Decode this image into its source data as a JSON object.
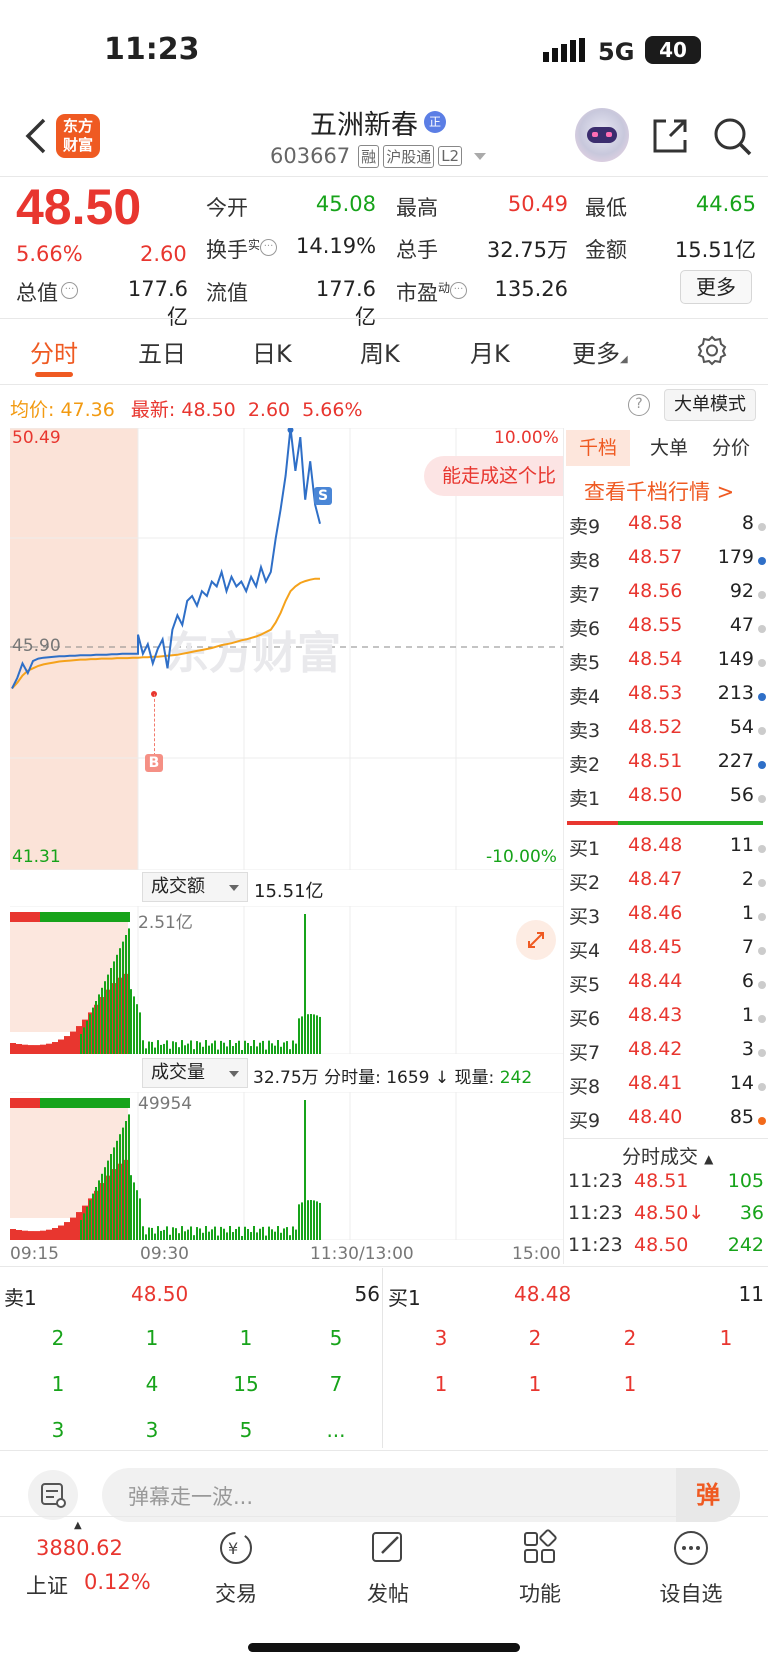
{
  "status_bar": {
    "time": "11:23",
    "network": "5G",
    "battery": "40"
  },
  "header": {
    "logo_line1": "东方",
    "logo_line2": "财富",
    "title": "五洲新春",
    "title_badge": "正",
    "code": "603667",
    "tags": [
      "融",
      "沪股通",
      "L2"
    ]
  },
  "quote": {
    "price": "48.50",
    "change_pct": "5.66%",
    "change": "2.60",
    "open_label": "今开",
    "open": "45.08",
    "high_label": "最高",
    "high": "50.49",
    "low_label": "最低",
    "low": "44.65",
    "turnover_label": "换手",
    "turnover_sup": "实",
    "turnover": "14.19%",
    "volume_label": "总手",
    "volume": "32.75万",
    "amount_label": "金额",
    "amount": "15.51亿",
    "mcap_label": "总值",
    "mcap": "177.6亿",
    "float_label": "流值",
    "float": "177.6亿",
    "pe_label": "市盈",
    "pe_sup": "动",
    "pe": "135.26",
    "more_button": "更多"
  },
  "tabs": [
    "分时",
    "五日",
    "日K",
    "周K",
    "月K",
    "更多"
  ],
  "chart_info": {
    "avg_label": "均价:",
    "avg": "47.36",
    "last_label": "最新:",
    "last": "48.50",
    "last_change": "2.60",
    "last_pct": "5.66%",
    "mode_button": "大单模式",
    "y_max": "50.49",
    "y_mid": "45.90",
    "y_min": "41.31",
    "pct_max": "10.00%",
    "pct_min": "-10.00%",
    "marker_s": "S",
    "marker_b": "B",
    "banner": "能走成这个比",
    "watermark": "东方财富"
  },
  "chart_data": {
    "type": "line",
    "ylim": [
      41.31,
      50.49
    ],
    "series": [
      {
        "name": "最新",
        "values": [
          45.08,
          45.3,
          45.6,
          45.4,
          45.65,
          45.7,
          45.72,
          45.73,
          45.74,
          45.75,
          45.75,
          45.76,
          45.76,
          45.77,
          45.77,
          45.77,
          45.78,
          45.78,
          45.78,
          45.79,
          45.79,
          45.8,
          45.8,
          45.8,
          45.8,
          46.2,
          45.8,
          46.0,
          45.6,
          45.9,
          46.1,
          45.5,
          46.3,
          46.6,
          46.4,
          46.9,
          47.0,
          46.8,
          47.1,
          47.0,
          47.3,
          47.2,
          47.5,
          47.1,
          47.4,
          47.2,
          47.3,
          47.1,
          47.4,
          47.2,
          47.6,
          47.3,
          47.5,
          48.2,
          48.8,
          49.5,
          50.49,
          49.6,
          50.3,
          49.0,
          49.8,
          48.9,
          48.5
        ]
      },
      {
        "name": "均价",
        "values": [
          45.08,
          45.2,
          45.35,
          45.45,
          45.5,
          45.55,
          45.58,
          45.6,
          45.62,
          45.64,
          45.65,
          45.66,
          45.67,
          45.68,
          45.68,
          45.69,
          45.69,
          45.7,
          45.7,
          45.7,
          45.71,
          45.71,
          45.71,
          45.72,
          45.72,
          45.72,
          45.73,
          45.73,
          45.74,
          45.74,
          45.75,
          45.76,
          45.77,
          45.78,
          45.8,
          45.82,
          45.84,
          45.86,
          45.88,
          45.9,
          45.92,
          45.95,
          45.98,
          46.0,
          46.02,
          46.05,
          46.08,
          46.1,
          46.13,
          46.16,
          46.2,
          46.25,
          46.3,
          46.45,
          46.65,
          46.9,
          47.1,
          47.2,
          47.27,
          47.31,
          47.34,
          47.36,
          47.36
        ]
      }
    ]
  },
  "amount_panel": {
    "selector": "成交额",
    "total": "15.51亿",
    "max": "2.51亿"
  },
  "volume_panel": {
    "selector": "成交量",
    "total": "32.75万",
    "minute_label": "分时量:",
    "minute": "1659",
    "cur_label": "现量:",
    "cur": "242",
    "max": "49954"
  },
  "time_axis": [
    "09:15",
    "09:30",
    "11:30/13:00",
    "15:00"
  ],
  "orderbook": {
    "tabs": [
      "千档",
      "大单",
      "分价"
    ],
    "link": "查看千档行情 >",
    "asks": [
      {
        "label": "卖9",
        "price": "48.58",
        "vol": "8",
        "dot": "#cccccc"
      },
      {
        "label": "卖8",
        "price": "48.57",
        "vol": "179",
        "dot": "#2f6fc7"
      },
      {
        "label": "卖7",
        "price": "48.56",
        "vol": "92",
        "dot": "#cccccc"
      },
      {
        "label": "卖6",
        "price": "48.55",
        "vol": "47",
        "dot": "#cccccc"
      },
      {
        "label": "卖5",
        "price": "48.54",
        "vol": "149",
        "dot": "#cccccc"
      },
      {
        "label": "卖4",
        "price": "48.53",
        "vol": "213",
        "dot": "#2f6fc7"
      },
      {
        "label": "卖3",
        "price": "48.52",
        "vol": "54",
        "dot": "#cccccc"
      },
      {
        "label": "卖2",
        "price": "48.51",
        "vol": "227",
        "dot": "#2f6fc7"
      },
      {
        "label": "卖1",
        "price": "48.50",
        "vol": "56",
        "dot": "#cccccc"
      }
    ],
    "bids": [
      {
        "label": "买1",
        "price": "48.48",
        "vol": "11",
        "dot": "#cccccc"
      },
      {
        "label": "买2",
        "price": "48.47",
        "vol": "2",
        "dot": "#cccccc"
      },
      {
        "label": "买3",
        "price": "48.46",
        "vol": "1",
        "dot": "#cccccc"
      },
      {
        "label": "买4",
        "price": "48.45",
        "vol": "7",
        "dot": "#cccccc"
      },
      {
        "label": "买5",
        "price": "48.44",
        "vol": "6",
        "dot": "#cccccc"
      },
      {
        "label": "买6",
        "price": "48.43",
        "vol": "1",
        "dot": "#cccccc"
      },
      {
        "label": "买7",
        "price": "48.42",
        "vol": "3",
        "dot": "#cccccc"
      },
      {
        "label": "买8",
        "price": "48.41",
        "vol": "14",
        "dot": "#cccccc"
      },
      {
        "label": "买9",
        "price": "48.40",
        "vol": "85",
        "dot": "#f26a1b"
      }
    ],
    "ticks_title": "分时成交",
    "ticks": [
      {
        "time": "11:23",
        "price": "48.51",
        "vol": "105"
      },
      {
        "time": "11:23",
        "price": "48.50↓",
        "vol": "36"
      },
      {
        "time": "11:23",
        "price": "48.50",
        "vol": "242"
      }
    ]
  },
  "queue": {
    "sell_label": "卖1",
    "sell_price": "48.50",
    "sell_vol": "56",
    "buy_label": "买1",
    "buy_price": "48.48",
    "buy_vol": "11",
    "sell_orders": [
      "2",
      "1",
      "1",
      "5",
      "1",
      "4",
      "15",
      "7",
      "3",
      "3",
      "5",
      "..."
    ],
    "buy_orders": [
      "3",
      "2",
      "2",
      "1",
      "1",
      "1",
      "1"
    ]
  },
  "danmu": {
    "placeholder": "弹幕走一波...",
    "button": "弹"
  },
  "bottom_nav": {
    "index_value": "3880.62",
    "index_name": "上证",
    "index_pct": "0.12%",
    "items": [
      "交易",
      "发帖",
      "功能",
      "设自选"
    ]
  }
}
